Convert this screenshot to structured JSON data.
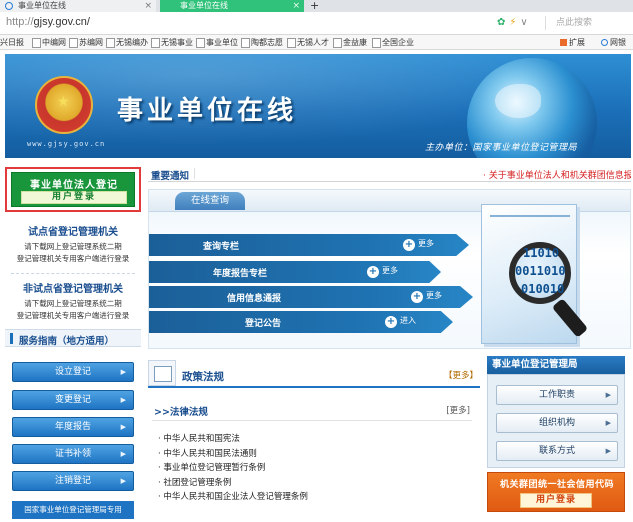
{
  "browser": {
    "tabs": [
      {
        "label": "事业单位在线",
        "active": false
      },
      {
        "label": "事业单位在线",
        "active": true
      }
    ],
    "new_tab_label": "+",
    "url_protocol": "http://",
    "url_host": "gjsy.gov.cn/",
    "search_placeholder": "点此搜索",
    "bookmarks": [
      "兴日报",
      "中编网",
      "苏编网",
      "无锡编办",
      "无锡事业",
      "事业单位",
      "陶都志愿",
      "无锡人才",
      "金益康",
      "全国企业"
    ],
    "extensions_label": "扩展",
    "net_label": "网银"
  },
  "banner": {
    "domain": "www.gjsy.gov.cn",
    "title": "事业单位在线",
    "host": "主办单位：国家事业单位登记管理局"
  },
  "left": {
    "login_title": "事业单位法人登记",
    "login_button": "用户登录",
    "pilot": {
      "title": "试点省登记管理机关",
      "desc_line1": "请下载网上登记管理系统二期",
      "desc_line2": "登记管理机关专用客户端进行登录"
    },
    "non_pilot": {
      "title": "非试点省登记管理机关",
      "desc_line1": "请下载网上登记管理系统二期",
      "desc_line2": "登记管理机关专用客户端进行登录"
    },
    "guide_title": "服务指南（地方适用）",
    "services": [
      "设立登记",
      "变更登记",
      "年度报告",
      "证书补领",
      "注销登记"
    ],
    "footer_link": "国家事业单位登记管理局专用"
  },
  "notice": {
    "label": "重要通知",
    "text": "· 关于事业单位法人和机关群团信息报"
  },
  "query": {
    "tab_label": "在线查询",
    "rows": [
      {
        "label": "查询专栏",
        "more": "更多"
      },
      {
        "label": "年度报告专栏",
        "more": "更多"
      },
      {
        "label": "信用信息通报",
        "more": "更多"
      },
      {
        "label": "登记公告",
        "more": "进入"
      }
    ],
    "binary_lines": [
      "11010",
      "0011010",
      "010010"
    ]
  },
  "policy": {
    "title": "政策法规",
    "more": "【更多】",
    "law_head": ">>法律法规",
    "law_more": "[更多]",
    "items": [
      "· 中华人民共和国宪法",
      "· 中华人民共和国民法通则",
      "· 事业单位登记管理暂行条例",
      "· 社团登记管理条例",
      "· 中华人民共和国企业法人登记管理条例"
    ]
  },
  "bureau": {
    "title": "事业单位登记管理局",
    "buttons": [
      "工作职责",
      "组织机构",
      "联系方式"
    ]
  },
  "credit": {
    "title": "机关群团统一社会信用代码",
    "button": "用户登录"
  }
}
